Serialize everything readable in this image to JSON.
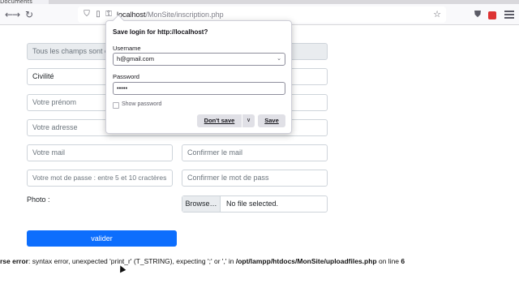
{
  "browser": {
    "tab_fragment": "Documents",
    "url_host": "localhost",
    "url_path": "/MonSite/inscription.php"
  },
  "form": {
    "notice_placeholder": "Tous les champs sont obligatoires",
    "civility_value": "Civilité",
    "firstname_placeholder": "Votre prénom",
    "address_placeholder": "Votre adresse",
    "email_placeholder": "Votre mail",
    "confirm_email_placeholder": "Confirmer le mail",
    "password_placeholder": "Votre mot de passe : entre 5 et 10 cractères",
    "confirm_password_placeholder": "Confirmer le mot de pass",
    "photo_label": "Photo :",
    "browse_label": "Browse…",
    "file_status": "No file selected.",
    "submit_label": "valider"
  },
  "error": {
    "prefix": "rse error",
    "message": ": syntax error, unexpected 'print_r' (T_STRING), expecting ';' or ',' in ",
    "file": "/opt/lampp/htdocs/MonSite/uploadfiles.php",
    "line_text": " on line ",
    "line_number": "6"
  },
  "save_login_popup": {
    "title": "Save login for http://localhost?",
    "username_label": "Username",
    "username_value": "h@gmail.com",
    "password_label": "Password",
    "password_value": "•••••",
    "show_password_label": "Show password",
    "dont_save_label": "Don't save",
    "save_label": "Save"
  }
}
